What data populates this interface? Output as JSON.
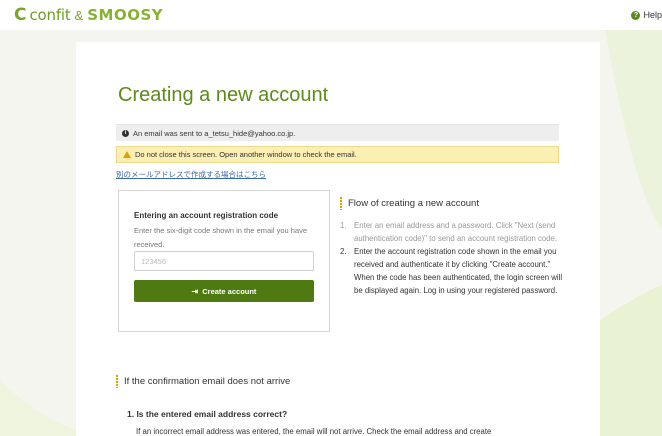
{
  "header": {
    "logo_c": "C",
    "logo_confit": "confit",
    "logo_amp": "&",
    "logo_smoosy": "SMOOSY",
    "help_label": "Help"
  },
  "page": {
    "title": "Creating a new account",
    "info_alert": "An email was sent to a_tetsu_hide@yahoo.co.jp.",
    "warn_alert": "Do not close this screen. Open another window to check the email.",
    "alt_link": "別のメールアドレスで作成する場合はこちら"
  },
  "code_form": {
    "label": "Entering an account registration code",
    "description": "Enter the six-digit code shown in the email you have received.",
    "input_value": "",
    "input_placeholder": "123456",
    "button_label": "Create account"
  },
  "flow": {
    "heading": "Flow of creating a new account",
    "steps": [
      {
        "num": "1.",
        "text": "Enter an email address and a password. Click \"Next (send authentication code)\" to send an account registration code."
      },
      {
        "num": "2.",
        "text": "Enter the account registration code shown in the email you received and authenticate it by clicking \"Create account.\"",
        "note": "When the code has been authenticated, the login screen will be displayed again. Log in using your registered password."
      }
    ]
  },
  "no_email": {
    "heading": "If the confirmation email does not arrive",
    "q1_title": "1. Is the entered email address correct?",
    "q1_text": "If an incorrect email address was entered, the email will not arrive. Check the email address and create"
  },
  "colors": {
    "brand_green": "#5d8a1a",
    "button_green": "#4f7a12",
    "warning_bg": "#fbefb4",
    "accent_orange": "#e0a000"
  }
}
